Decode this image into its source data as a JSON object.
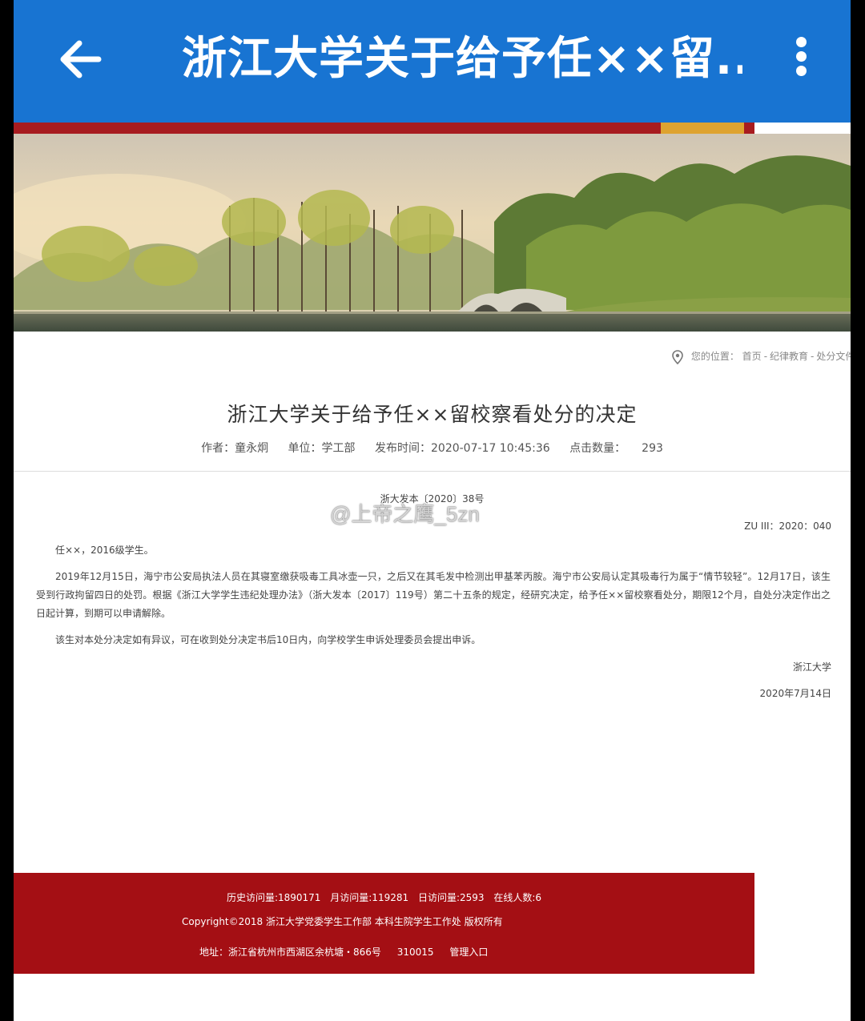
{
  "appbar": {
    "title": "浙江大学关于给予任××留...",
    "back_icon": "arrow-left-icon",
    "menu_icon": "more-vertical-icon",
    "background_color": "#1874d2"
  },
  "theme": {
    "red": "#a71c20",
    "gold": "#dea330",
    "footer_red": "#a40f14"
  },
  "breadcrumb": {
    "prefix": "您的位置：",
    "items": [
      "首页",
      "纪律教育",
      "处分文件"
    ]
  },
  "article": {
    "title": "浙江大学关于给予任××留校察看处分的决定",
    "meta": {
      "author": "作者：童永炯",
      "unit": "单位：学工部",
      "published": "发布时间：2020-07-17 10:45:36",
      "clicks_label": "点击数量：",
      "clicks": "293"
    },
    "doc_number": "浙大发本〔2020〕38号",
    "archive_code": "ZU III：2020：040",
    "paragraphs": [
      "任××，2016级学生。",
      "2019年12月15日，海宁市公安局执法人员在其寝室缴获吸毒工具冰壶一只，之后又在其毛发中检测出甲基苯丙胺。海宁市公安局认定其吸毒行为属于“情节较轻”。12月17日，该生受到行政拘留四日的处罚。根据《浙江大学学生违纪处理办法》（浙大发本〔2017〕119号）第二十五条的规定，经研究决定，给予任××留校察看处分，期限12个月，自处分决定作出之日起计算，到期可以申请解除。",
      "该生对本处分决定如有异议，可在收到处分决定书后10日内，向学校学生申诉处理委员会提出申诉。"
    ],
    "signature_org": "浙江大学",
    "signature_date": "2020年7月14日"
  },
  "watermark": "@上帝之鹰_5zn",
  "footer": {
    "stats": [
      "历史访问量:1890171",
      "月访问量:119281",
      "日访问量:2593",
      "在线人数:6"
    ],
    "copyright": "Copyright©2018 浙江大学党委学生工作部 本科生院学生工作处 版权所有",
    "address": "地址：浙江省杭州市西湖区余杭塘・866号",
    "postcode": "310015",
    "admin_link": "管理入口"
  }
}
